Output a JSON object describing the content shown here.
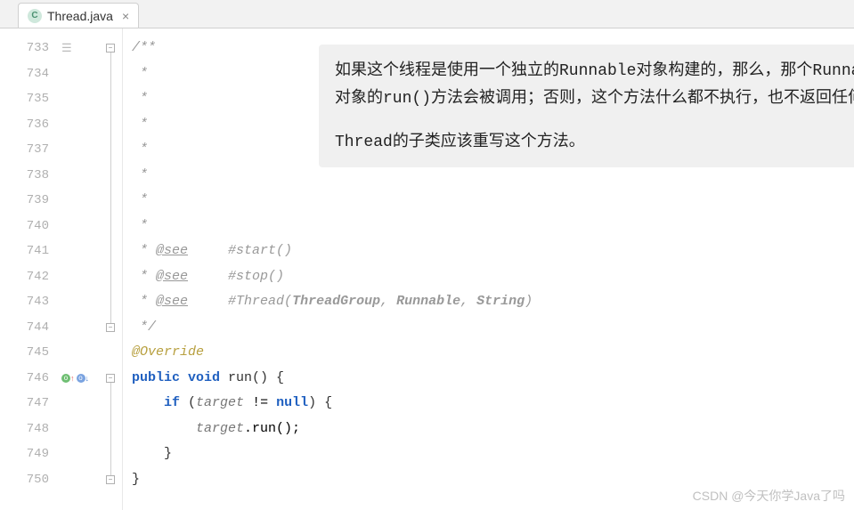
{
  "tab": {
    "icon_letter": "C",
    "filename": "Thread.java",
    "close_glyph": "×"
  },
  "gutter": {
    "start": 733,
    "count": 18
  },
  "tooltip": {
    "p1_a": "如果这个线程是使用一个独立的",
    "p1_b": "Runnable",
    "p1_c": "对象构建的，那么，那个",
    "p1_d": "Runnable",
    "p1_e": "对象的",
    "p1_f": "run()",
    "p1_g": "方法会被调用；否则，这个方法什么都不执行，也不返回任何值。",
    "p2_a": "Thread",
    "p2_b": "的子类应该重写这个方法。"
  },
  "code": {
    "l733": "/**",
    "l734": " *",
    "l735": " *",
    "l736": " *",
    "l737": " *",
    "l738": " *",
    "l739": " *",
    "l740": " *",
    "l741_pre": " * ",
    "l741_tag": "@see",
    "l741_post": "     #start()",
    "l742_pre": " * ",
    "l742_tag": "@see",
    "l742_post": "     #stop()",
    "l743_pre": " * ",
    "l743_tag": "@see",
    "l743_post_a": "     #Thread(",
    "l743_post_b": "ThreadGroup",
    "l743_post_c": ", ",
    "l743_post_d": "Runnable",
    "l743_post_e": ", ",
    "l743_post_f": "String",
    "l743_post_g": ")",
    "l744": " */",
    "l745": "@Override",
    "l746_kw1": "public ",
    "l746_kw2": "void ",
    "l746_name": "run",
    "l746_rest": "() {",
    "l747_kw": "if ",
    "l747_a": "(",
    "l747_b": "target",
    "l747_c": " != ",
    "l747_d": "null",
    "l747_e": ") {",
    "l748_a": "target",
    "l748_b": ".run();",
    "l749": "}",
    "l750": "}"
  },
  "watermark": "CSDN @今天你学Java了吗"
}
